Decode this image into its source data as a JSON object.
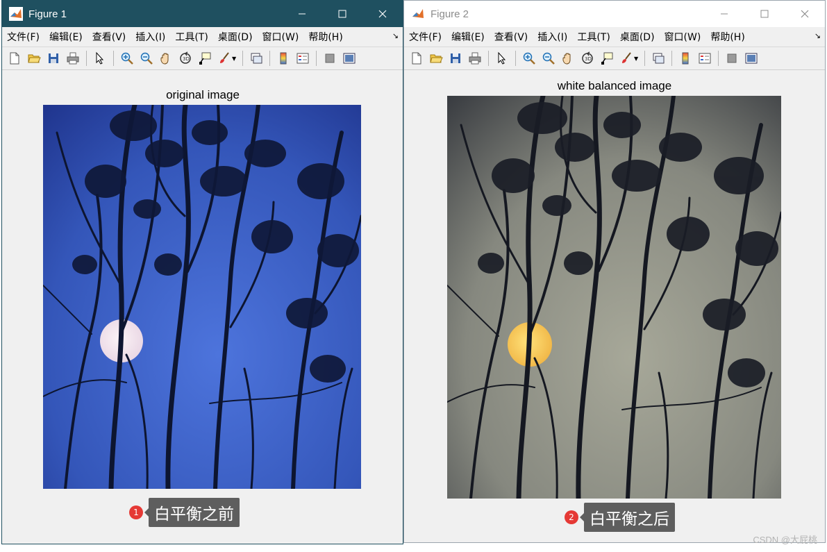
{
  "figures": [
    {
      "window_title": "Figure 1",
      "menu": [
        "文件(F)",
        "编辑(E)",
        "查看(V)",
        "插入(I)",
        "工具(T)",
        "桌面(D)",
        "窗口(W)",
        "帮助(H)"
      ],
      "axes_title": "original image",
      "annotation_number": "1",
      "annotation_text": "白平衡之前"
    },
    {
      "window_title": "Figure 2",
      "menu": [
        "文件(F)",
        "编辑(E)",
        "查看(V)",
        "插入(I)",
        "工具(T)",
        "桌面(D)",
        "窗口(W)",
        "帮助(H)"
      ],
      "axes_title": "white balanced image",
      "annotation_number": "2",
      "annotation_text": "白平衡之后"
    }
  ],
  "watermark": "CSDN @大屁桃",
  "colors": {
    "active_titlebar": "#1f5060",
    "original_sky_top": "#1c2f86",
    "original_sky_mid": "#4d74dc",
    "balanced_sky_top": "#2d3037",
    "balanced_sky_mid": "#9c9d91",
    "moon_original": "#f5e8ee",
    "moon_balanced": "#ffd45c"
  }
}
